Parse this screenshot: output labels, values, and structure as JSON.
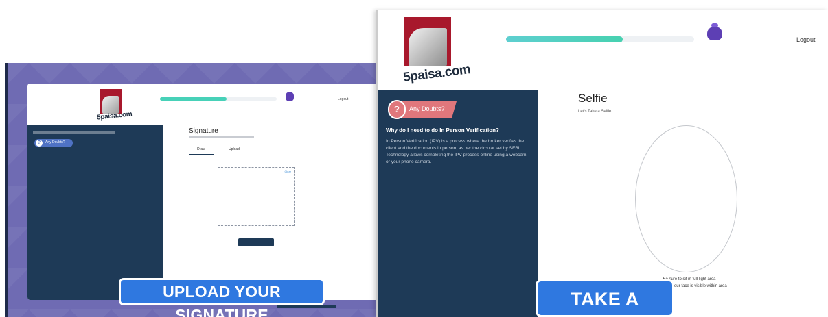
{
  "left_screen": {
    "logo_text": "5paisa.com",
    "progress": {
      "percent_label": "",
      "fill_fraction": 0.57
    },
    "logout_label": "Logout",
    "sidebar": {
      "pill_label": "Any Doubts?",
      "bullet_text": ""
    },
    "main": {
      "title": "Signature",
      "tabs": [
        "Draw",
        "Upload"
      ],
      "draw_label": "",
      "clear_label": "Clear",
      "save_label": ""
    },
    "banner": "UPLOAD YOUR SIGNATURE"
  },
  "right_screen": {
    "logo_text": "5paisa.com",
    "progress": {
      "percent_label": "",
      "fill_fraction": 0.62
    },
    "bag_caption": "",
    "logout_label": "Logout",
    "sidebar": {
      "doubt_label": "Any Doubts?",
      "question": "Why do I need to do In Person Verification?",
      "answer": "In Person Verification (IPV) is a process where the broker verifies the client and the documents in person, as per the circular set by SEBI. Technology allows completing the IPV process online using a webcam or your phone camera."
    },
    "main": {
      "title": "Selfie",
      "subtitle": "Let's Take a Selfie",
      "hint_1": "Be sure to sit in full light area",
      "hint_2": "Make sure your face is visible within area"
    },
    "banner": "TAKE A SELFIE"
  },
  "colors": {
    "sidebar_bg": "#1e3a57",
    "progress_fill": "#47d1b8",
    "banner_bg": "#2f78e0",
    "logo_red": "#a8182c",
    "doubt_pill": "#e0777c",
    "backdrop": "#6f6bb3"
  },
  "icons": [
    "question-mark-icon",
    "money-bag-icon"
  ]
}
